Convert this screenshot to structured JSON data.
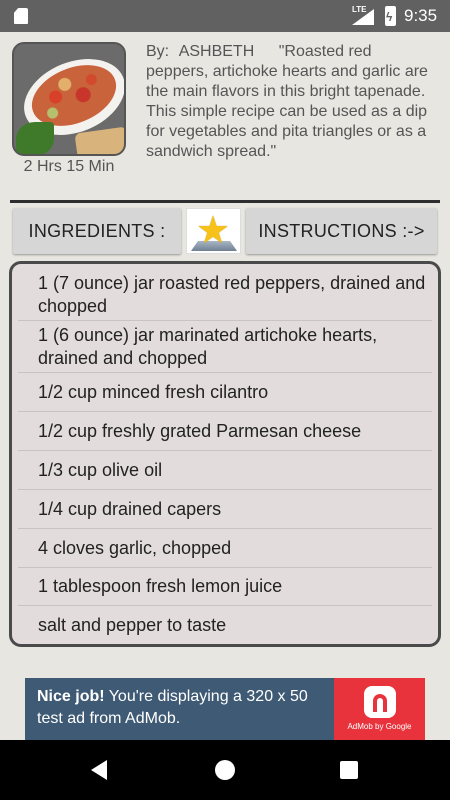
{
  "status_bar": {
    "time": "9:35",
    "network": "LTE"
  },
  "recipe": {
    "author_label": "By:",
    "author": "ASHBETH",
    "description": "\"Roasted red peppers, artichoke hearts and garlic are the main flavors in this bright tapenade. This simple recipe can be used as a dip for vegetables and pita triangles or as a sandwich spread.\"",
    "cook_time": "2 Hrs 15 Min"
  },
  "tabs": {
    "ingredients_label": "INGREDIENTS :",
    "instructions_label": "INSTRUCTIONS :->",
    "favorite_icon": "star-icon"
  },
  "ingredients": [
    "1 (7 ounce) jar roasted red peppers, drained and chopped",
    "1 (6 ounce) jar marinated artichoke hearts, drained and chopped",
    "1/2 cup minced fresh cilantro",
    "1/2 cup freshly grated Parmesan cheese",
    "1/3 cup olive oil",
    "1/4 cup drained capers",
    "4 cloves garlic, chopped",
    "1 tablespoon fresh lemon juice",
    "salt and pepper to taste"
  ],
  "ad": {
    "headline": "Nice job!",
    "text": "You're displaying a 320 x 50 test ad from AdMob.",
    "brand": "AdMob by Google"
  },
  "colors": {
    "status_bar": "#616161",
    "ad_background": "#3f5a74",
    "admob_red": "#e8333c",
    "star": "#f6c21a"
  }
}
